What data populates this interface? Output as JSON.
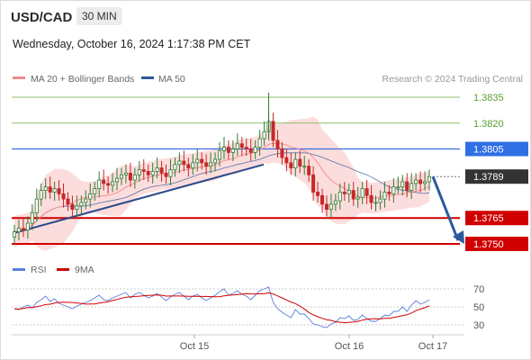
{
  "header": {
    "symbol": "USD/CAD",
    "timeframe": "30 MIN",
    "datetime": "Wednesday, October 16, 2024 1:17:38 PM CET"
  },
  "legend": {
    "ma20": "MA 20 + Bollinger Bands",
    "ma50": "MA 50",
    "copyright": "Research © 2024 Trading Central"
  },
  "rsi_legend": {
    "rsi": "RSI",
    "ma9": "9MA"
  },
  "colors": {
    "up": "#2e7d32",
    "down": "#c62828",
    "ma20": "#f08a8a",
    "ma50": "#2b5797",
    "band": "#fbd2d2",
    "resistance": "#3b6fe0",
    "support": "#d10000",
    "green_level": "#8bbf6a",
    "current": "#333333",
    "trend": "#2a4a8c",
    "arrow": "#2c5a9e",
    "rsi": "#5b7fd8",
    "rsi_ma": "#d10000"
  },
  "chart_data": {
    "type": "candlestick",
    "y_range": [
      1.3742,
      1.3848
    ],
    "x_labels": [
      "Oct 15",
      "Oct 16",
      "Oct 17"
    ],
    "levels": [
      {
        "value": "1.3835",
        "price": 1.3835,
        "kind": "target"
      },
      {
        "value": "1.3820",
        "price": 1.382,
        "kind": "target"
      },
      {
        "value": "1.3805",
        "price": 1.3805,
        "kind": "resistance"
      },
      {
        "value": "1.3789",
        "price": 1.3789,
        "kind": "current"
      },
      {
        "value": "1.3765",
        "price": 1.3765,
        "kind": "support"
      },
      {
        "value": "1.3750",
        "price": 1.375,
        "kind": "support"
      }
    ],
    "rsi_levels": [
      "70",
      "50",
      "30"
    ],
    "rsi_range": [
      20,
      80
    ],
    "candles_close_estimate": [
      1.3757,
      1.3759,
      1.3758,
      1.3762,
      1.3768,
      1.3776,
      1.3781,
      1.3783,
      1.378,
      1.3782,
      1.3779,
      1.3776,
      1.3773,
      1.377,
      1.3772,
      1.3774,
      1.3776,
      1.3779,
      1.3782,
      1.3787,
      1.3785,
      1.3784,
      1.3786,
      1.3788,
      1.379,
      1.3791,
      1.3787,
      1.379,
      1.3793,
      1.3792,
      1.379,
      1.3792,
      1.3794,
      1.3791,
      1.3789,
      1.3793,
      1.3796,
      1.3798,
      1.3796,
      1.3794,
      1.3797,
      1.3799,
      1.3797,
      1.3795,
      1.3797,
      1.3799,
      1.3804,
      1.3806,
      1.3803,
      1.3805,
      1.3808,
      1.3806,
      1.3805,
      1.3803,
      1.3806,
      1.3811,
      1.3815,
      1.3821,
      1.381,
      1.3805,
      1.38,
      1.3797,
      1.3794,
      1.3799,
      1.3795,
      1.3795,
      1.379,
      1.378,
      1.3778,
      1.3773,
      1.377,
      1.3773,
      1.3775,
      1.378,
      1.3779,
      1.3781,
      1.3776,
      1.3777,
      1.3782,
      1.3778,
      1.3774,
      1.3774,
      1.3776,
      1.378,
      1.3779,
      1.3783,
      1.3783,
      1.3786,
      1.3781,
      1.3785,
      1.3787,
      1.3785,
      1.3786,
      1.3789
    ],
    "rsi_values_estimate": [
      48,
      47,
      50,
      52,
      49,
      55,
      58,
      62,
      56,
      59,
      54,
      52,
      50,
      48,
      51,
      53,
      55,
      57,
      60,
      63,
      58,
      57,
      60,
      62,
      64,
      66,
      60,
      64,
      66,
      63,
      60,
      62,
      65,
      61,
      57,
      61,
      64,
      66,
      62,
      58,
      62,
      64,
      60,
      57,
      60,
      63,
      67,
      70,
      63,
      65,
      68,
      64,
      62,
      58,
      63,
      68,
      70,
      72,
      55,
      48,
      44,
      41,
      38,
      47,
      42,
      42,
      37,
      31,
      30,
      28,
      27,
      31,
      33,
      38,
      37,
      40,
      35,
      36,
      41,
      37,
      34,
      34,
      37,
      41,
      40,
      45,
      45,
      50,
      45,
      52,
      57,
      53,
      55,
      58
    ]
  }
}
